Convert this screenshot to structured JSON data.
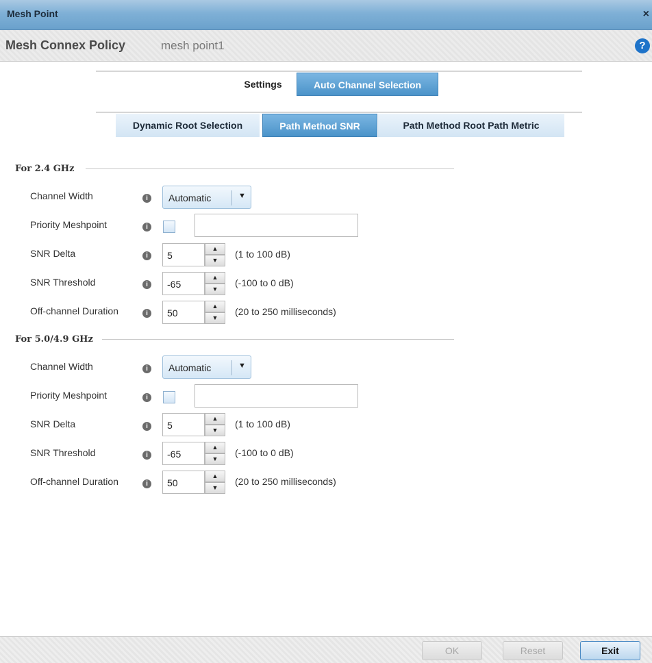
{
  "window": {
    "title": "Mesh Point",
    "close_label": "×"
  },
  "header": {
    "title": "Mesh Connex Policy",
    "subtitle": "mesh point1",
    "help_label": "?"
  },
  "tabs_top": [
    {
      "label": "Settings",
      "active": false
    },
    {
      "label": "Auto Channel Selection",
      "active": true
    }
  ],
  "tabs_sub": [
    {
      "label": "Dynamic Root Selection",
      "active": false
    },
    {
      "label": "Path Method SNR",
      "active": true
    },
    {
      "label": "Path Method Root Path Metric",
      "active": false
    }
  ],
  "info_glyph": "i",
  "bands": [
    {
      "heading": "For 2.4 GHz",
      "channel_width": {
        "label": "Channel Width",
        "value": "Automatic",
        "caret": "▼"
      },
      "priority_meshpoint": {
        "label": "Priority Meshpoint",
        "checked": false,
        "value": ""
      },
      "snr_delta": {
        "label": "SNR Delta",
        "value": "5",
        "range": "(1 to 100 dB)"
      },
      "snr_threshold": {
        "label": "SNR Threshold",
        "value": "-65",
        "range": "(-100 to 0 dB)"
      },
      "off_channel_duration": {
        "label": "Off-channel Duration",
        "value": "50",
        "range": "(20 to 250 milliseconds)"
      }
    },
    {
      "heading": "For 5.0/4.9 GHz",
      "channel_width": {
        "label": "Channel Width",
        "value": "Automatic",
        "caret": "▼"
      },
      "priority_meshpoint": {
        "label": "Priority Meshpoint",
        "checked": false,
        "value": ""
      },
      "snr_delta": {
        "label": "SNR Delta",
        "value": "5",
        "range": "(1 to 100 dB)"
      },
      "snr_threshold": {
        "label": "SNR Threshold",
        "value": "-65",
        "range": "(-100 to 0 dB)"
      },
      "off_channel_duration": {
        "label": "Off-channel Duration",
        "value": "50",
        "range": "(20 to 250 milliseconds)"
      }
    }
  ],
  "spin": {
    "up": "▲",
    "down": "▼"
  },
  "footer": {
    "ok_label": "OK",
    "reset_label": "Reset",
    "exit_label": "Exit"
  }
}
